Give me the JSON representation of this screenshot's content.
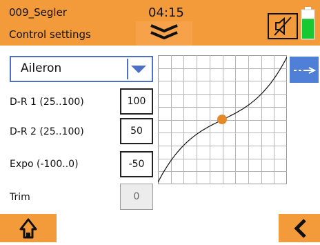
{
  "header": {
    "model_name": "009_Segler",
    "subtitle": "Control settings",
    "time": "04:15",
    "battery_level": 0.7,
    "colors": {
      "header_bg": "#f39a3a",
      "battery_fill": "#18c832"
    }
  },
  "selector": {
    "value": "Aileron"
  },
  "settings": [
    {
      "label": "D-R 1 (25..100)",
      "value": "100"
    },
    {
      "label": "D-R 2 (25..100)",
      "value": "50"
    },
    {
      "label": "Expo (-100..0)",
      "value": "-50"
    },
    {
      "label": "Trim",
      "value": "0"
    }
  ],
  "icons": {
    "menu": "chevron-double-down-icon",
    "mute": "speaker-muted-icon",
    "battery": "battery-icon",
    "curve_toggle": "curve-line-icon",
    "home": "home-icon",
    "back": "chevron-left-icon"
  }
}
